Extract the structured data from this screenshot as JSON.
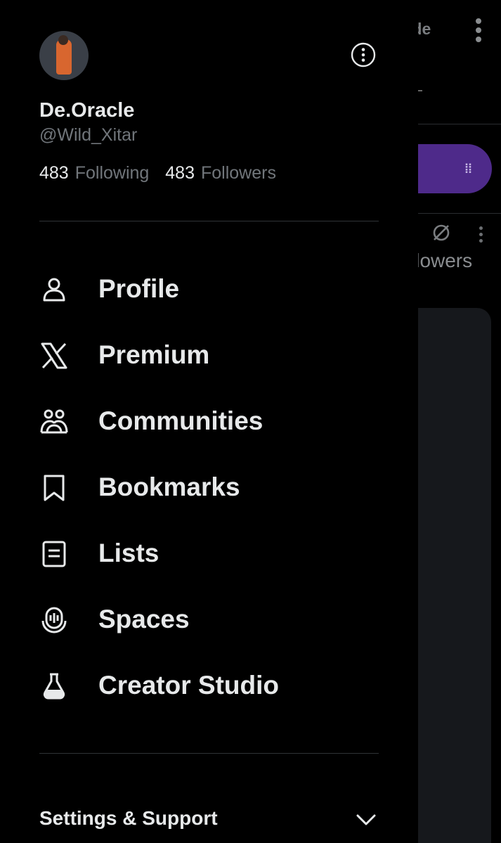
{
  "background": {
    "upgrade_fragment": "ıde",
    "followers_fragment": "llowers",
    "pill_icon": "⁞⁞",
    "accent_color": "#4e2a8a"
  },
  "profile": {
    "display_name": "De.Oracle",
    "handle": "@Wild_Xitar",
    "following_count": "483",
    "following_label": "Following",
    "followers_count": "483",
    "followers_label": "Followers",
    "avatar_icon": "avatar-photo"
  },
  "menu": {
    "items": [
      {
        "label": "Profile",
        "icon": "person-icon"
      },
      {
        "label": "Premium",
        "icon": "x-logo-icon"
      },
      {
        "label": "Communities",
        "icon": "communities-icon"
      },
      {
        "label": "Bookmarks",
        "icon": "bookmark-icon"
      },
      {
        "label": "Lists",
        "icon": "list-icon"
      },
      {
        "label": "Spaces",
        "icon": "spaces-icon"
      },
      {
        "label": "Creator Studio",
        "icon": "flask-icon"
      }
    ]
  },
  "footer": {
    "settings_label": "Settings & Support",
    "chevron_icon": "chevron-down-icon"
  },
  "colors": {
    "text_primary": "#e7e9ea",
    "text_secondary": "#71767b",
    "divider": "#2f3336",
    "background": "#000000"
  }
}
